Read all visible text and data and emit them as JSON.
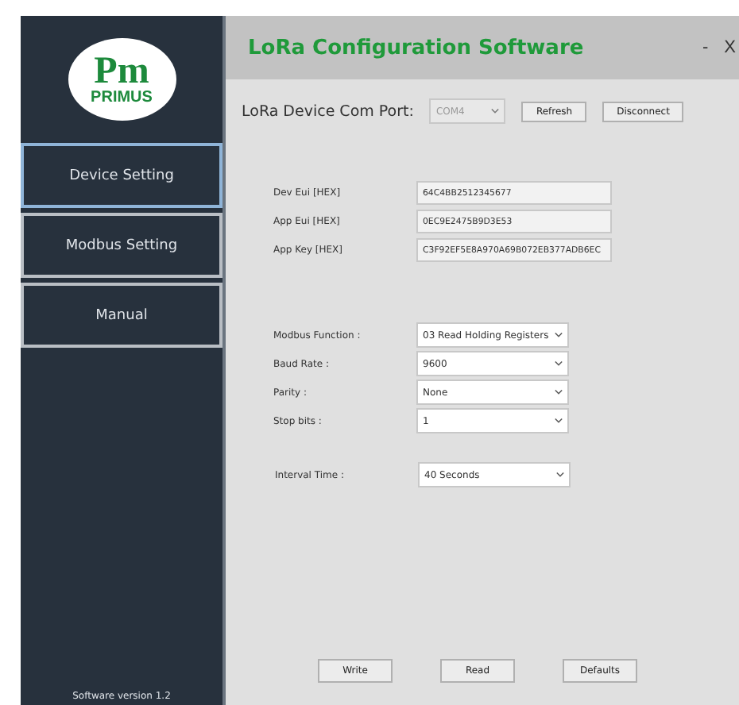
{
  "logo": {
    "mark": "Pm",
    "text": "PRIMUS"
  },
  "nav": [
    {
      "label": "Device Setting",
      "selected": true
    },
    {
      "label": "Modbus Setting",
      "selected": false
    },
    {
      "label": "Manual",
      "selected": false
    }
  ],
  "version": "Software version 1.2",
  "window": {
    "title": "LoRa Configuration Software",
    "minimize": "-",
    "close": "X"
  },
  "com_port": {
    "label": "LoRa Device Com Port:",
    "value": "COM4",
    "disabled": true,
    "buttons": [
      "Refresh",
      "Disconnect"
    ]
  },
  "keys": [
    {
      "label": "Dev Eui [HEX]",
      "value": "64C4BB2512345677"
    },
    {
      "label": "App Eui [HEX]",
      "value": "0EC9E2475B9D3E53"
    },
    {
      "label": "App Key [HEX]",
      "value": "C3F92EF5E8A970A69B072EB377ADB6EC"
    }
  ],
  "settings": [
    {
      "label": "Modbus Function :",
      "value": "03 Read Holding Registers"
    },
    {
      "label": "Baud Rate :",
      "value": "9600"
    },
    {
      "label": "Parity :",
      "value": "None"
    },
    {
      "label": "Stop bits :",
      "value": "1"
    }
  ],
  "interval": {
    "label": "Interval Time :",
    "value": "40 Seconds"
  },
  "actions": [
    "Write",
    "Read",
    "Defaults"
  ]
}
